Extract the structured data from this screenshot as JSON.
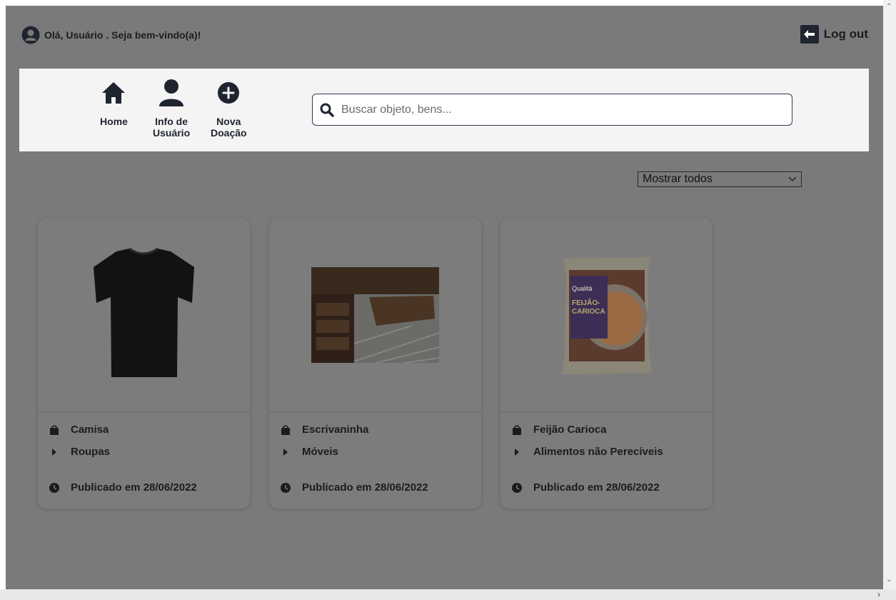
{
  "header": {
    "greeting": "Olá, Usuário . Seja bem-vindo(a)!",
    "logout_label": "Log out"
  },
  "nav": {
    "items": [
      {
        "label": "Home",
        "icon": "home-icon"
      },
      {
        "label": "Info de\nUsuário",
        "icon": "user-icon"
      },
      {
        "label": "Nova\nDoação",
        "icon": "plus-circle-icon"
      }
    ]
  },
  "search": {
    "placeholder": "Buscar objeto, bens..."
  },
  "filter": {
    "selected": "Mostrar todos"
  },
  "cards": [
    {
      "name": "Camisa",
      "category": "Roupas",
      "published": "Publicado em 28/06/2022",
      "image": "black-tshirt"
    },
    {
      "name": "Escrivaninha",
      "category": "Móveis",
      "published": "Publicado em 28/06/2022",
      "image": "wooden-desk"
    },
    {
      "name": "Feijão Carioca",
      "category": "Alimentos não Perecíveis",
      "published": "Publicado em 28/06/2022",
      "image": "bean-package"
    }
  ],
  "package_text": {
    "brand": "Qualitá",
    "line1": "FEIJÃO-",
    "line2": "CARIOCA"
  },
  "colors": {
    "overlay": "#7a7a7a",
    "nav_panel": "#f4f4f4",
    "icon_dark": "#1f2430",
    "search_border": "#2b3b57"
  }
}
